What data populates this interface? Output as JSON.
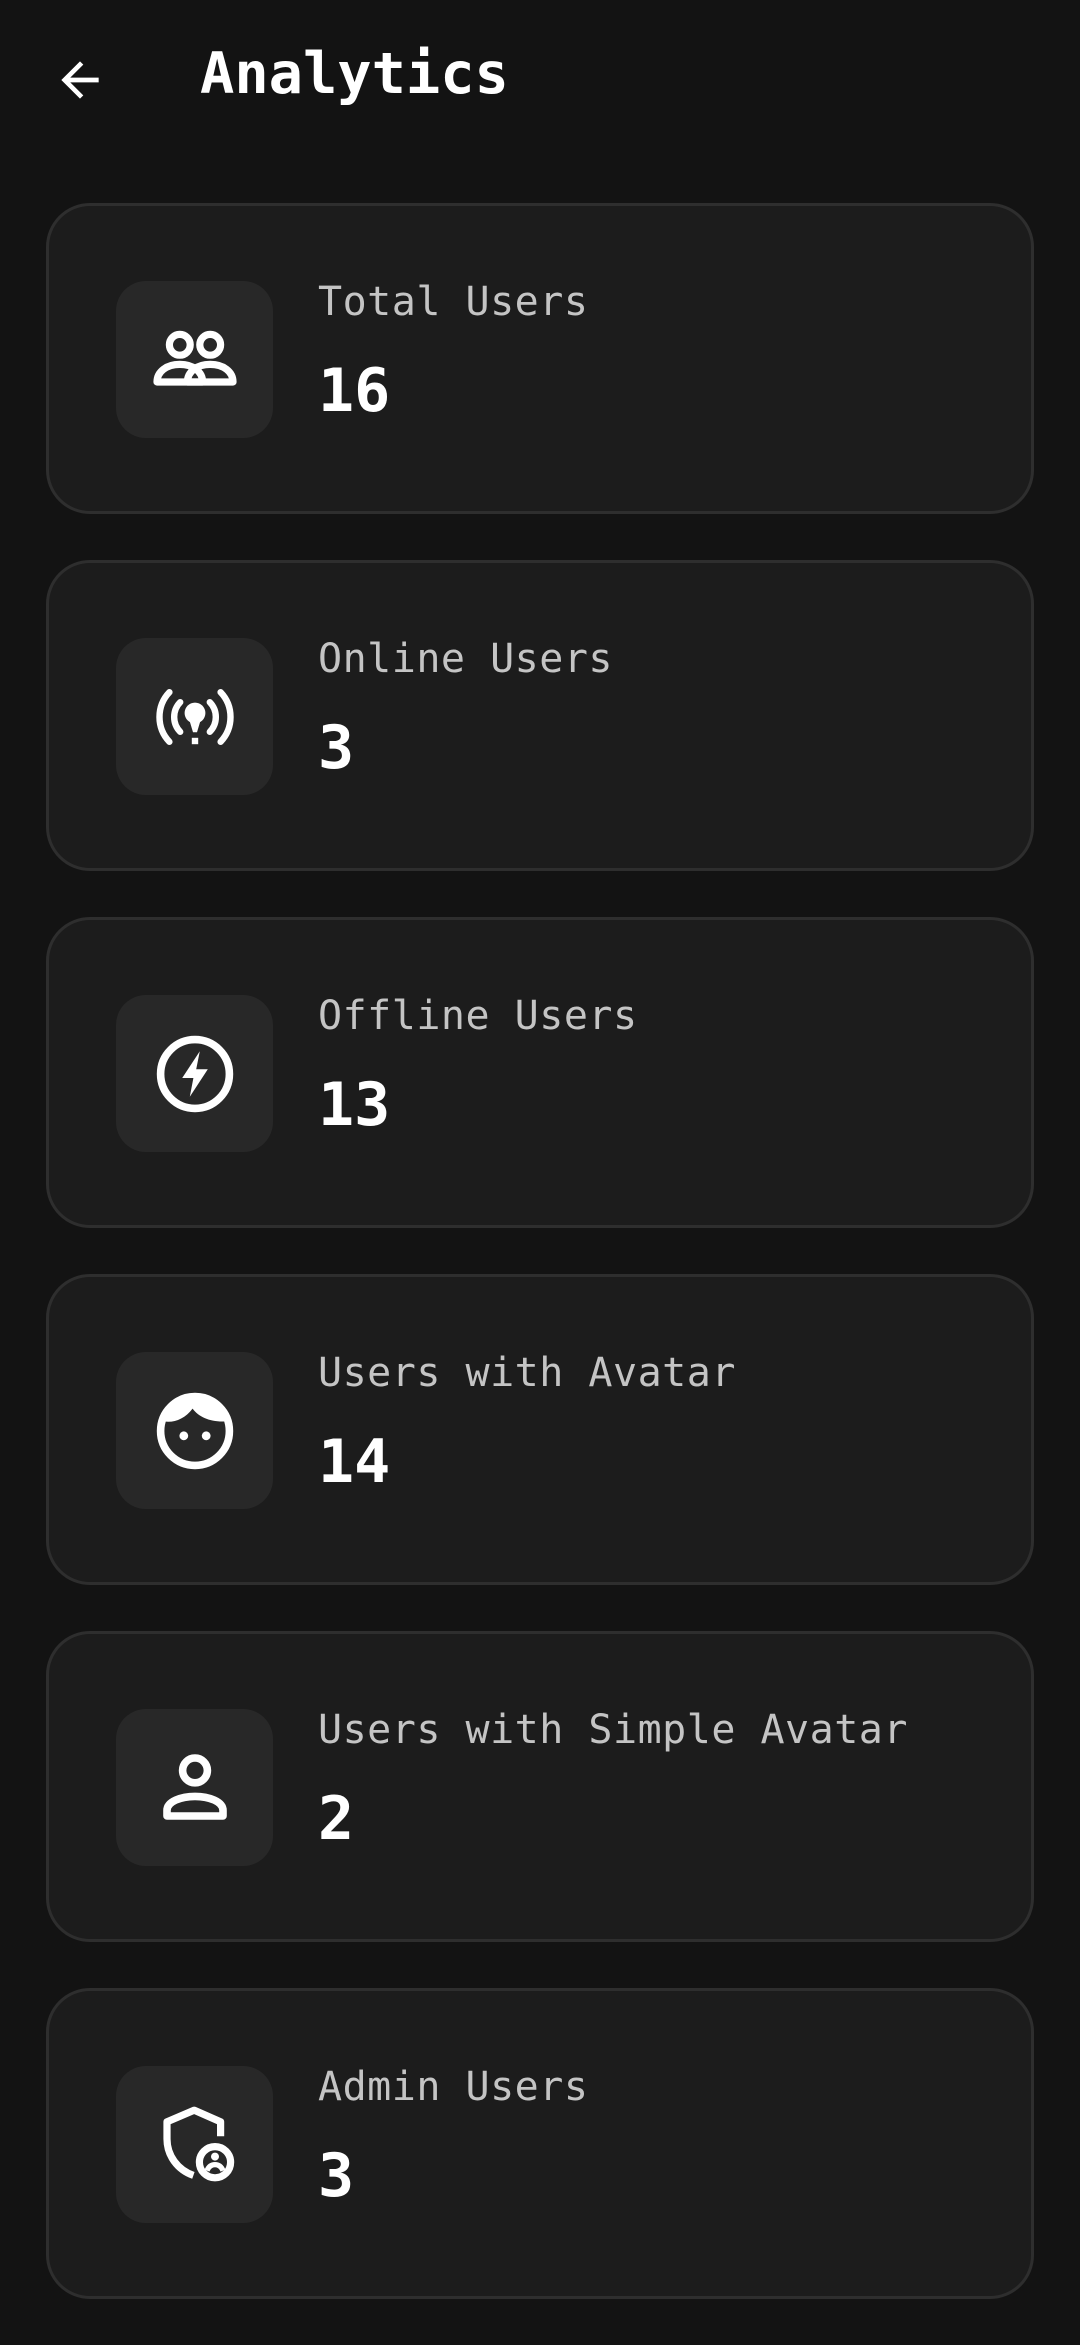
{
  "app_bar": {
    "title": "Analytics",
    "back_icon": "arrow-back-icon"
  },
  "theme": {
    "background": "#131313",
    "card_background": "#1c1c1c",
    "card_border": "#2e2e2e",
    "icon_tile_background": "#282828",
    "label_color": "#c4c4c4",
    "value_color": "#ffffff"
  },
  "stats": [
    {
      "label": "Total Users",
      "value": "16",
      "icon": "group-icon"
    },
    {
      "label": "Online Users",
      "value": "3",
      "icon": "broadcast-icon"
    },
    {
      "label": "Offline Users",
      "value": "13",
      "icon": "bolt-circle-icon"
    },
    {
      "label": "Users with Avatar",
      "value": "14",
      "icon": "face-icon"
    },
    {
      "label": "Users with Simple Avatar",
      "value": "2",
      "icon": "person-icon"
    },
    {
      "label": "Admin Users",
      "value": "3",
      "icon": "admin-shield-icon"
    }
  ]
}
